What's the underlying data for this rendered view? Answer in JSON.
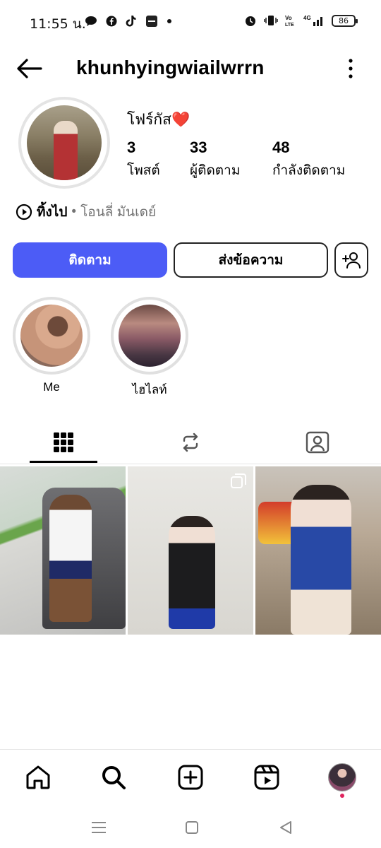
{
  "status_bar": {
    "time": "11:55 น.",
    "battery": "86"
  },
  "header": {
    "username": "khunhyingwiailwrrn"
  },
  "profile": {
    "display_name": "โฟร์กัส❤️",
    "stats": [
      {
        "count": "3",
        "label": "โพสต์"
      },
      {
        "count": "33",
        "label": "ผู้ติดตาม"
      },
      {
        "count": "48",
        "label": "กำลังติดตาม"
      }
    ],
    "note_title": "ทิ้งไป",
    "note_separator": "•",
    "note_sub": "โอนลี่ มันเดย์"
  },
  "actions": {
    "follow_label": "ติดตาม",
    "message_label": "ส่งข้อความ"
  },
  "highlights": [
    {
      "label": "Me"
    },
    {
      "label": "ไฮไลท์"
    }
  ],
  "tabs": [
    "grid-icon",
    "repost-icon",
    "tagged-icon"
  ],
  "colors": {
    "follow_button": "#4c5cf6",
    "notification_dot": "#e0245e"
  },
  "bottom_nav": [
    "home-icon",
    "search-icon",
    "create-icon",
    "reels-icon",
    "profile-avatar"
  ]
}
